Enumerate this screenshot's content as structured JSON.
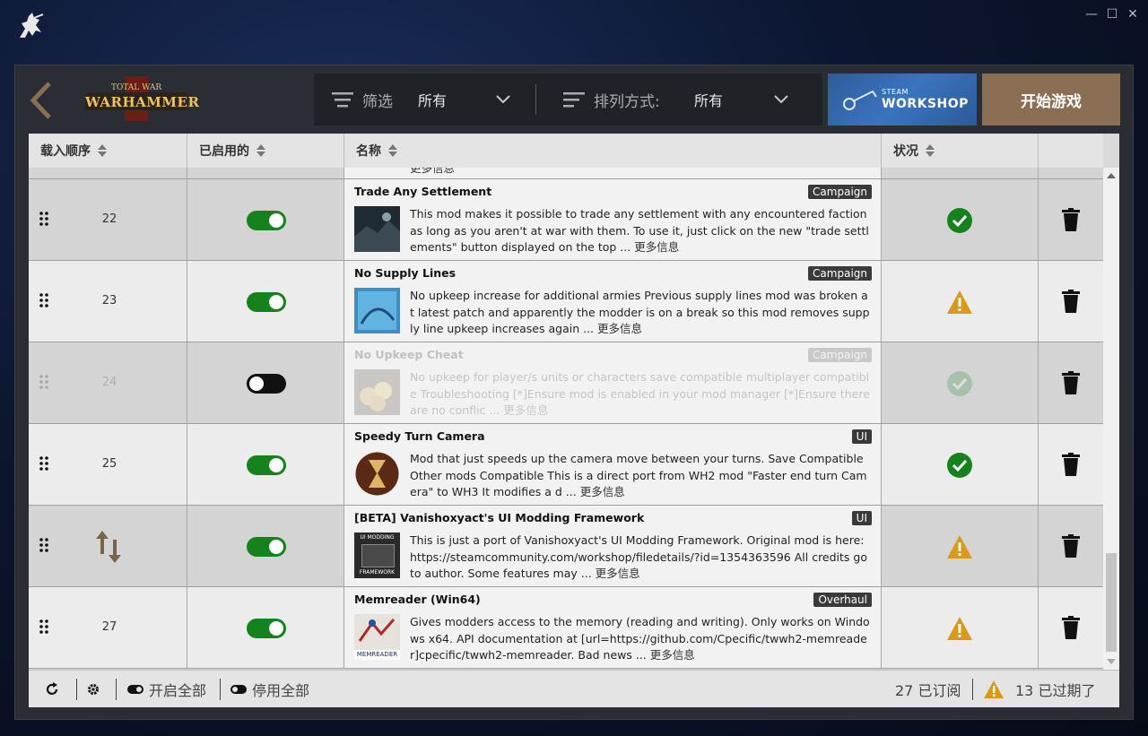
{
  "window": {
    "minimize": "—",
    "maximize": "☐",
    "close": "✕"
  },
  "header": {
    "game_logo_line1": "TOTAL WAR",
    "game_logo_line2": "WARHAMMER",
    "filter_label": "筛选",
    "filter_value": "所有",
    "sort_label": "排列方式:",
    "sort_value": "所有",
    "workshop_small": "STEAM",
    "workshop_big": "WORKSHOP",
    "play_label": "开始游戏"
  },
  "columns": {
    "order": "载入顺序",
    "enabled": "已启用的",
    "name": "名称",
    "status": "状况"
  },
  "rows": [
    {
      "order": "22",
      "enabled": true,
      "title": "Trade Any Settlement",
      "tag": "Campaign",
      "desc": "This mod makes it possible to trade any settlement with any encountered faction as long as you aren't at war with them. To use it, just click on the new \"trade settlements\" button displayed on the top ...",
      "more": "更多信息",
      "status": "ok",
      "thumb": "dark-landscape"
    },
    {
      "order": "23",
      "enabled": true,
      "title": "No Supply Lines",
      "tag": "Campaign",
      "desc": "No upkeep increase for additional armies  Previous supply lines mod was broken at latest patch and apparently the modder is on a break so this mod removes supply line upkeep increases again ...",
      "more": "更多信息",
      "status": "warning",
      "thumb": "no-supply-lines-thumb"
    },
    {
      "order": "24",
      "enabled": false,
      "title": "No Upkeep Cheat",
      "tag": "Campaign",
      "desc": "No upkeep for player/s units or characters   save compatible  multiplayer compatible   Troubleshooting  [*]Ensure mod is enabled in your mod manager [*]Ensure there are no conflic ...",
      "more": "更多信息",
      "status": "ok",
      "thumb": "gold-coins-thumb"
    },
    {
      "order": "25",
      "enabled": true,
      "title": "Speedy Turn Camera",
      "tag": "UI",
      "desc": "Mod that just speeds up the camera move between your turns.    Save Compatible  Other mods Compatible    This is a direct port from WH2 mod \"Faster end turn Camera\" to WH3  It modifies a d ...",
      "more": "更多信息",
      "status": "ok",
      "thumb": "hourglass-thumb"
    },
    {
      "order": "",
      "enabled": true,
      "title": "[BETA] Vanishoxyact's UI Modding Framework",
      "tag": "UI",
      "desc": "This is just a port of Vanishoxyact's UI Modding Framework. Original mod is here: https://steamcommunity.com/workshop/filedetails/?id=1354363596 All credits go to author. Some features may ...",
      "more": "更多信息",
      "status": "warning",
      "thumb": "ui-modding-framework-thumb",
      "thumb_text_top": "UI MODDING",
      "thumb_text_bottom": "FRAMEWORK"
    },
    {
      "order": "27",
      "enabled": true,
      "title": "Memreader (Win64)",
      "tag": "Overhaul",
      "desc": "Gives modders access to the memory (reading and writing). Only works on Windows x64. API documentation at [url=https://github.com/Cpecific/twwh2-memreader]cpecific/twwh2-memreader.  Bad news ...",
      "more": "更多信息",
      "status": "warning",
      "thumb": "memreader-thumb",
      "thumb_text": "MEMREADER"
    }
  ],
  "partial_row_text": "更多信息",
  "footer": {
    "enable_all": "开启全部",
    "disable_all": "停用全部",
    "subscribed": "27 已订阅",
    "outdated": "13 已过期了"
  },
  "colors": {
    "accent": "#8a6f55",
    "toggle_on": "#16821e",
    "ok": "#16821e",
    "warning": "#d99a1b"
  }
}
